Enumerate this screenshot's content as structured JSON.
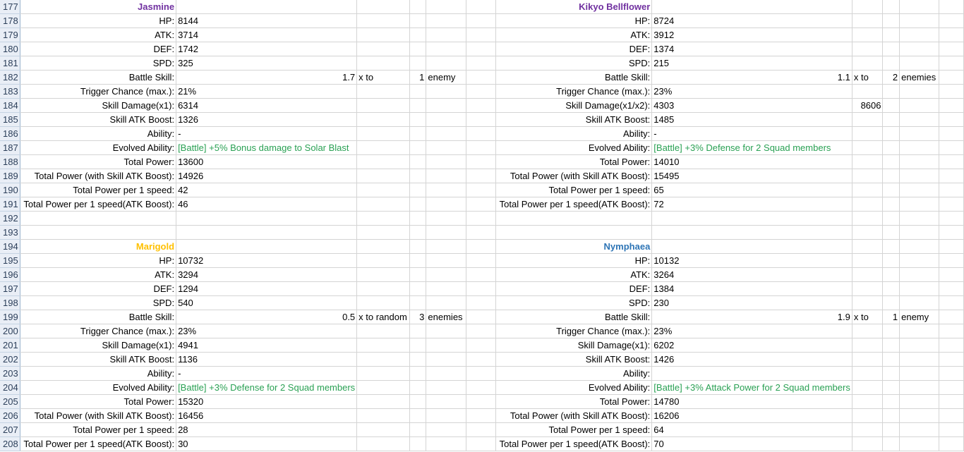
{
  "colors": {
    "jasmine": "#7030a0",
    "kikyo": "#7030a0",
    "marigold": "#ffc000",
    "nymphaea": "#2e75b6",
    "ability_green": "#2aa154"
  },
  "row_numbers": [
    "177",
    "178",
    "179",
    "180",
    "181",
    "182",
    "183",
    "184",
    "185",
    "186",
    "187",
    "188",
    "189",
    "190",
    "191",
    "192",
    "193",
    "194",
    "195",
    "196",
    "197",
    "198",
    "199",
    "200",
    "201",
    "202",
    "203",
    "204",
    "205",
    "206",
    "207",
    "208"
  ],
  "blocks": {
    "jasmine": {
      "name": "Jasmine",
      "rows": [
        {
          "label": "HP:",
          "value": "8144"
        },
        {
          "label": "ATK:",
          "value": "3714"
        },
        {
          "label": "DEF:",
          "value": "1742"
        },
        {
          "label": "SPD:",
          "value": "325"
        },
        {
          "label": "Battle Skill:",
          "mult": "1.7",
          "x_text": "x to",
          "count": "1",
          "target": "enemy"
        },
        {
          "label": "Trigger Chance (max.):",
          "value": "21%"
        },
        {
          "label": "Skill Damage(x1):",
          "value": "6314"
        },
        {
          "label": "Skill ATK Boost:",
          "value": "1326"
        },
        {
          "label": "Ability:",
          "value": "-"
        },
        {
          "label": "Evolved Ability:",
          "value": "[Battle] +5% Bonus damage to Solar Blast"
        },
        {
          "label": "Total Power:",
          "value": "13600"
        },
        {
          "label": "Total Power (with Skill ATK Boost):",
          "value": "14926"
        },
        {
          "label": "Total Power per 1 speed:",
          "value": "42"
        },
        {
          "label": "Total Power per 1 speed(ATK Boost):",
          "value": "46"
        }
      ]
    },
    "kikyo": {
      "name": "Kikyo Bellflower",
      "rows": [
        {
          "label": "HP:",
          "value": "8724"
        },
        {
          "label": "ATK:",
          "value": "3912"
        },
        {
          "label": "DEF:",
          "value": "1374"
        },
        {
          "label": "SPD:",
          "value": "215"
        },
        {
          "label": "Battle Skill:",
          "mult": "1.1",
          "x_text": "x to",
          "count": "2",
          "target": "enemies"
        },
        {
          "label": "Trigger Chance (max.):",
          "value": "23%"
        },
        {
          "label": "Skill Damage(x1/x2):",
          "value": "4303",
          "value2": "8606"
        },
        {
          "label": "Skill ATK Boost:",
          "value": "1485"
        },
        {
          "label": "Ability:",
          "value": "-"
        },
        {
          "label": "Evolved Ability:",
          "value": "[Battle] +3% Defense for 2 Squad members"
        },
        {
          "label": "Total Power:",
          "value": "14010"
        },
        {
          "label": "Total Power (with Skill ATK Boost):",
          "value": "15495"
        },
        {
          "label": "Total Power per 1 speed:",
          "value": "65"
        },
        {
          "label": "Total Power per 1 speed(ATK Boost):",
          "value": "72"
        }
      ]
    },
    "marigold": {
      "name": "Marigold",
      "rows": [
        {
          "label": "HP:",
          "value": "10732"
        },
        {
          "label": "ATK:",
          "value": "3294"
        },
        {
          "label": "DEF:",
          "value": "1294"
        },
        {
          "label": "SPD:",
          "value": "540"
        },
        {
          "label": "Battle Skill:",
          "mult": "0.5",
          "x_text": "x to random",
          "count": "3",
          "target": "enemies"
        },
        {
          "label": "Trigger Chance (max.):",
          "value": "23%"
        },
        {
          "label": "Skill Damage(x1):",
          "value": "4941"
        },
        {
          "label": "Skill ATK Boost:",
          "value": "1136"
        },
        {
          "label": "Ability:",
          "value": "-"
        },
        {
          "label": "Evolved Ability:",
          "value": "[Battle] +3% Defense for 2 Squad members"
        },
        {
          "label": "Total Power:",
          "value": "15320"
        },
        {
          "label": "Total Power (with Skill ATK Boost):",
          "value": "16456"
        },
        {
          "label": "Total Power per 1 speed:",
          "value": "28"
        },
        {
          "label": "Total Power per 1 speed(ATK Boost):",
          "value": "30"
        }
      ]
    },
    "nymphaea": {
      "name": "Nymphaea",
      "rows": [
        {
          "label": "HP:",
          "value": "10132"
        },
        {
          "label": "ATK:",
          "value": "3264"
        },
        {
          "label": "DEF:",
          "value": "1384"
        },
        {
          "label": "SPD:",
          "value": "230"
        },
        {
          "label": "Battle Skill:",
          "mult": "1.9",
          "x_text": "x to",
          "count": "1",
          "target": "enemy"
        },
        {
          "label": "Trigger Chance (max.):",
          "value": "23%"
        },
        {
          "label": "Skill Damage(x1):",
          "value": "6202"
        },
        {
          "label": "Skill ATK Boost:",
          "value": "1426"
        },
        {
          "label": "Ability:",
          "value": ""
        },
        {
          "label": "Evolved Ability:",
          "value": "[Battle] +3% Attack Power for 2 Squad members"
        },
        {
          "label": "Total Power:",
          "value": "14780"
        },
        {
          "label": "Total Power (with Skill ATK Boost):",
          "value": "16206"
        },
        {
          "label": "Total Power per 1 speed:",
          "value": "64"
        },
        {
          "label": "Total Power per 1 speed(ATK Boost):",
          "value": "70"
        }
      ]
    }
  }
}
